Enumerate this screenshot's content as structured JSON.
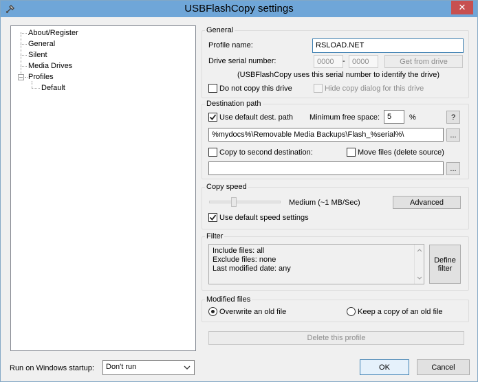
{
  "window": {
    "title": "USBFlashCopy settings",
    "close": "✕"
  },
  "tree": {
    "items": [
      {
        "label": "About/Register"
      },
      {
        "label": "General"
      },
      {
        "label": "Silent"
      },
      {
        "label": "Media Drives"
      },
      {
        "label": "Profiles"
      },
      {
        "label": "Default"
      }
    ],
    "expander": "–"
  },
  "general": {
    "group_label": "General",
    "profile_name_label": "Profile name:",
    "profile_name_value": "RSLOAD.NET",
    "serial_label": "Drive serial number:",
    "serial_part1": "0000",
    "serial_dash": "-",
    "serial_part2": "0000",
    "get_from_drive": "Get from drive",
    "serial_note": "(USBFlashCopy uses this serial number to identify the drive)",
    "do_not_copy": "Do not copy this drive",
    "hide_dialog": "Hide copy dialog for this drive"
  },
  "destination": {
    "group_label": "Destination path",
    "use_default": "Use default dest. path",
    "min_free_label": "Minimum free space:",
    "min_free_value": "5",
    "percent": "%",
    "help": "?",
    "path_value": "%mydocs%\\Removable Media Backups\\Flash_%serial%\\",
    "browse": "...",
    "second_dest": "Copy to second destination:",
    "move_files": "Move files (delete source)",
    "second_path_value": "",
    "browse2": "..."
  },
  "speed": {
    "group_label": "Copy speed",
    "speed_text": "Medium (~1 MB/Sec)",
    "advanced": "Advanced",
    "use_default_speed": "Use default speed settings"
  },
  "filter": {
    "group_label": "Filter",
    "lines": [
      "Include files: all",
      "Exclude files: none",
      "Last modified date: any"
    ],
    "define_line1": "Define",
    "define_line2": "filter"
  },
  "modified": {
    "group_label": "Modified files",
    "overwrite": "Overwrite an old file",
    "keep_copy": "Keep a copy of an old file"
  },
  "delete_profile": "Delete this profile",
  "startup": {
    "label": "Run on Windows startup:",
    "value": "Don't run"
  },
  "ok": "OK",
  "cancel": "Cancel"
}
